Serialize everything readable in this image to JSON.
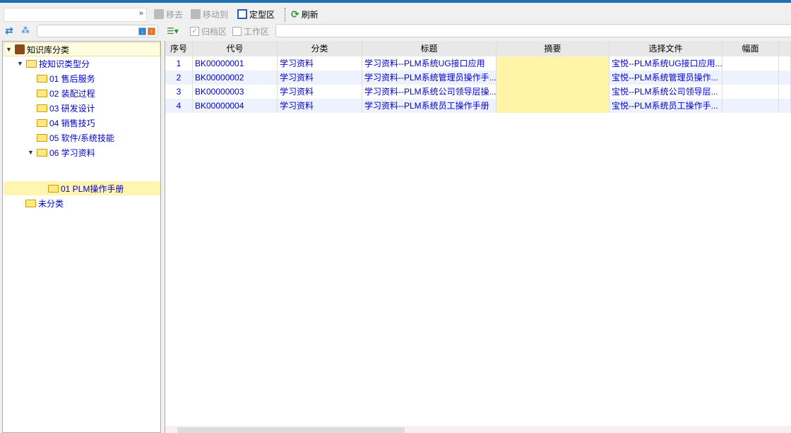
{
  "toolbar": {
    "remove": "移去",
    "move_to": "移动到",
    "fixed_area": "定型区",
    "refresh": "刷新"
  },
  "left": {
    "tree": [
      {
        "label": "知识库分类",
        "level": 0
      },
      {
        "label": "按知识类型分",
        "level": 1
      },
      {
        "label": "01 售后服务",
        "level": 2
      },
      {
        "label": "02 装配过程",
        "level": 2
      },
      {
        "label": "03 研发设计",
        "level": 2
      },
      {
        "label": "04 销售技巧",
        "level": 2
      },
      {
        "label": "05 软件/系统技能",
        "level": 2
      },
      {
        "label": "06 学习资料",
        "level": 2
      },
      {
        "label": "01 PLM操作手册",
        "level": 3,
        "selected": true
      },
      {
        "label": "未分类",
        "level": 1
      }
    ]
  },
  "filter": {
    "archive": "归档区",
    "work": "工作区",
    "archive_checked": true,
    "work_checked": false
  },
  "grid": {
    "columns": [
      "序号",
      "代号",
      "分类",
      "标题",
      "摘要",
      "选择文件",
      "幅面"
    ],
    "rows": [
      [
        "1",
        "BK00000001",
        "学习资料",
        "学习资料--PLM系统UG接口应用",
        "",
        "宝悦--PLM系统UG接口应用...",
        ""
      ],
      [
        "2",
        "BK00000002",
        "学习资料",
        "学习资料--PLM系统管理员操作手...",
        "",
        "宝悦--PLM系统管理员操作...",
        ""
      ],
      [
        "3",
        "BK00000003",
        "学习资料",
        "学习资料--PLM系统公司领导层操...",
        "",
        "宝悦--PLM系统公司领导层...",
        ""
      ],
      [
        "4",
        "BK00000004",
        "学习资料",
        "学习资料--PLM系统员工操作手册",
        "",
        "宝悦--PLM系统员工操作手...",
        ""
      ]
    ]
  }
}
